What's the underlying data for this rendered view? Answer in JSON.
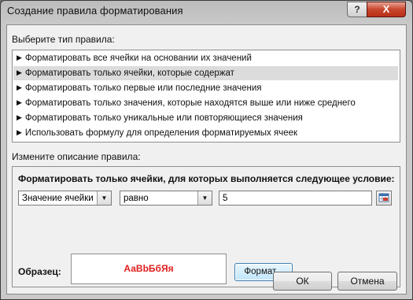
{
  "window": {
    "title": "Создание правила форматирования",
    "help_label": "?",
    "close_label": "X"
  },
  "rule_type": {
    "label": "Выберите тип правила:",
    "items": [
      {
        "label": "Форматировать все ячейки на основании их значений",
        "selected": false
      },
      {
        "label": "Форматировать только ячейки, которые содержат",
        "selected": true
      },
      {
        "label": "Форматировать только первые или последние значения",
        "selected": false
      },
      {
        "label": "Форматировать только значения, которые находятся выше или ниже среднего",
        "selected": false
      },
      {
        "label": "Форматировать только уникальные или повторяющиеся значения",
        "selected": false
      },
      {
        "label": "Использовать формулу для определения форматируемых ячеек",
        "selected": false
      }
    ]
  },
  "description": {
    "label": "Измените описание правила:",
    "condition_title": "Форматировать только ячейки, для которых выполняется следующее условие:",
    "field_select": "Значение ячейки",
    "operator_select": "равно",
    "value": "5",
    "sample_label": "Образец:",
    "sample_text": "АаВbБбЯя",
    "sample_color": "#e02020",
    "format_button": "Формат..."
  },
  "buttons": {
    "ok": "ОК",
    "cancel": "Отмена"
  }
}
